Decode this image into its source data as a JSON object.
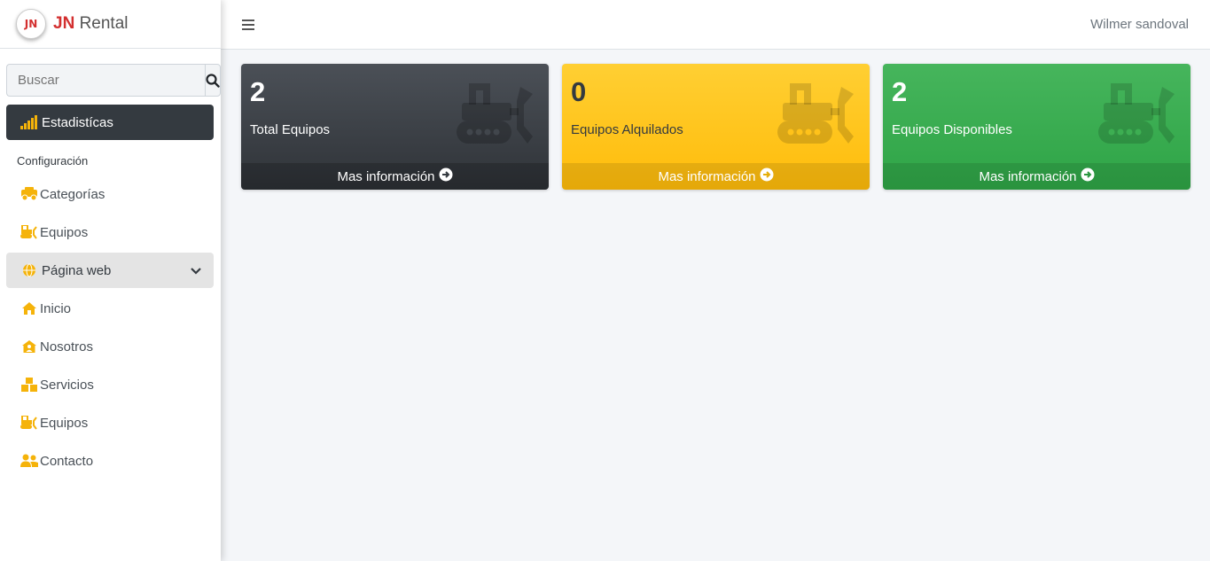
{
  "brand": {
    "logo_text": "JN",
    "name_bold": "JN",
    "name_rest": "Rental"
  },
  "search": {
    "placeholder": "Buscar"
  },
  "sidebar": {
    "items": [
      {
        "label": "Estadistícas"
      },
      {
        "label": "Configuración"
      },
      {
        "label": "Categorías"
      },
      {
        "label": "Equipos"
      },
      {
        "label": "Página web"
      },
      {
        "label": "Inicio"
      },
      {
        "label": "Nosotros"
      },
      {
        "label": "Servicios"
      },
      {
        "label": "Equipos"
      },
      {
        "label": "Contacto"
      }
    ]
  },
  "topbar": {
    "user": "Wilmer sandoval"
  },
  "cards": [
    {
      "number": "2",
      "label": "Total Equipos",
      "footer": "Mas información",
      "color": "#343a40"
    },
    {
      "number": "0",
      "label": "Equipos Alquilados",
      "footer": "Mas información",
      "color": "#ffc107"
    },
    {
      "number": "2",
      "label": "Equipos Disponibles",
      "footer": "Mas información",
      "color": "#28a745"
    }
  ],
  "icons": {
    "accent": "#f5b30a",
    "stats": "signal-bars-icon",
    "category": "vehicles-icon",
    "equipment": "bulldozer-icon",
    "web": "globe-icon",
    "home": "home-icon",
    "about": "house-user-icon",
    "services": "boxes-icon",
    "contact": "users-icon",
    "more": "arrow-circle-right-icon"
  }
}
